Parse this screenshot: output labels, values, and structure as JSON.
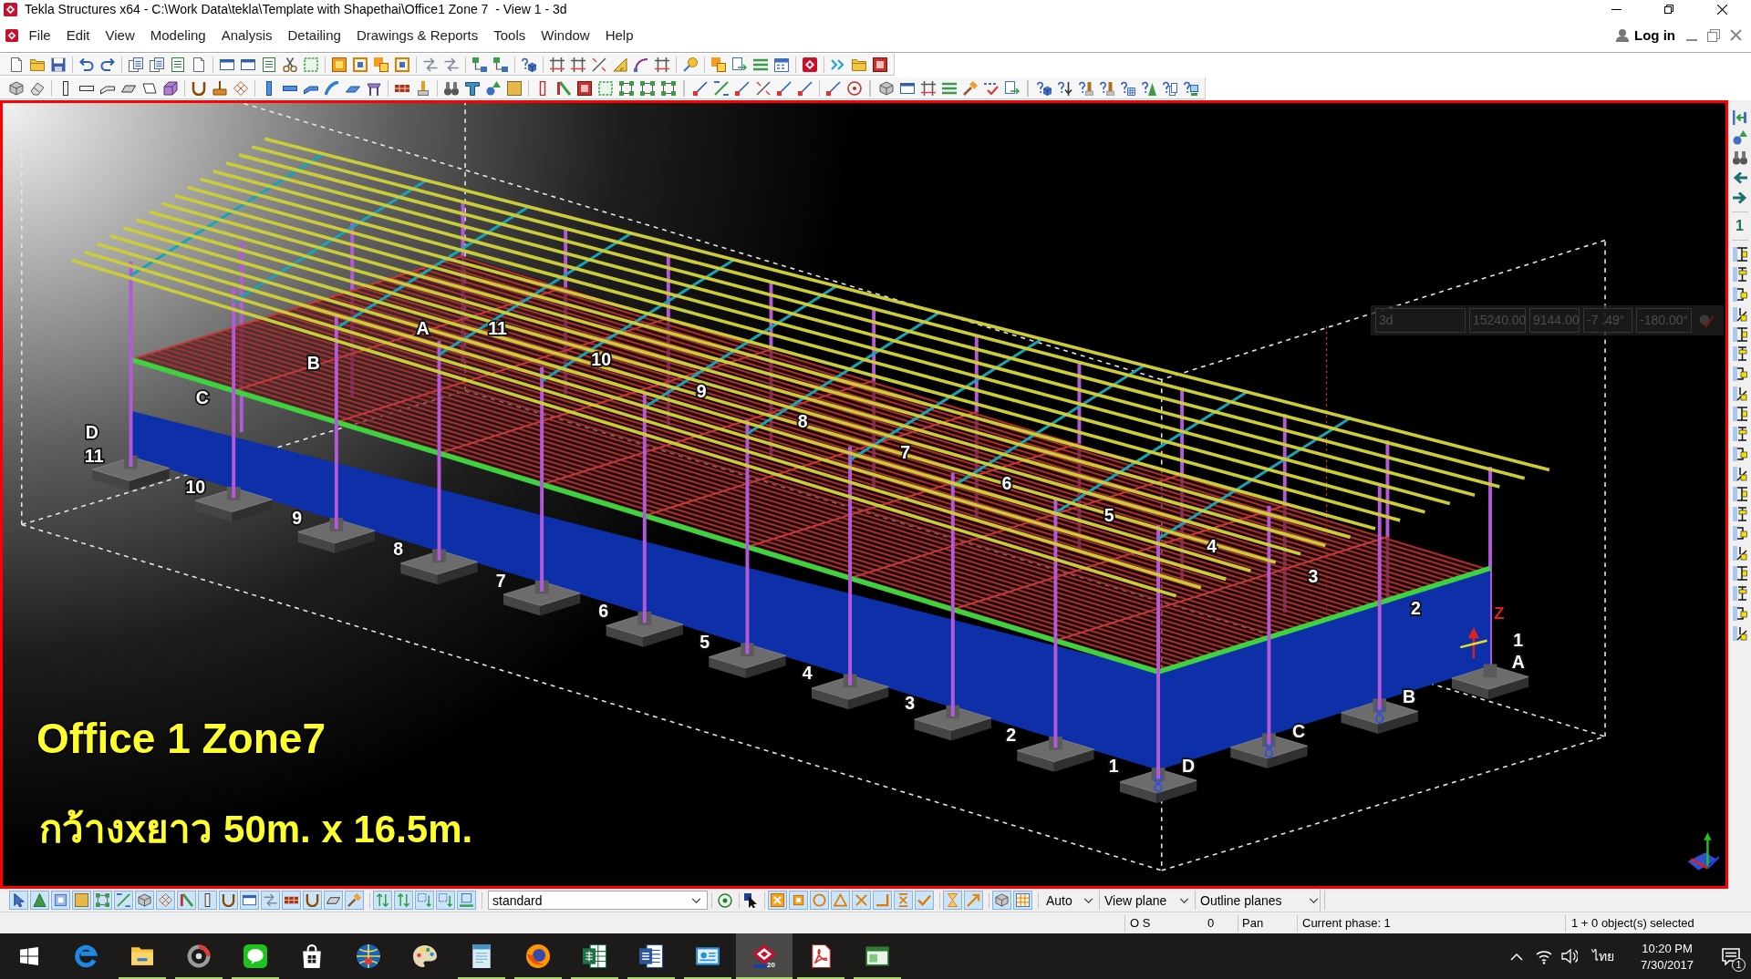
{
  "window": {
    "title": "Tekla Structures x64 - C:\\Work Data\\tekla\\Template with Shapethai\\Office1 Zone 7  - View 1 - 3d"
  },
  "menu": {
    "items": [
      "File",
      "Edit",
      "View",
      "Modeling",
      "Analysis",
      "Detailing",
      "Drawings & Reports",
      "Tools",
      "Window",
      "Help"
    ],
    "login": "Log in"
  },
  "model_view": {
    "view_fields": [
      "3d",
      "15240.00",
      "9144.00",
      "-7 .49°",
      "-180.00°"
    ],
    "grid_labels": [
      "A",
      "11",
      "10",
      "9",
      "8",
      "7",
      "6",
      "5",
      "4",
      "3",
      "2",
      "1",
      "B",
      "C",
      "D",
      "11",
      "10",
      "9",
      "8",
      "7",
      "6",
      "5",
      "4",
      "3",
      "2",
      "1",
      "D",
      "C",
      "B",
      "A"
    ],
    "axis_label": "Z",
    "overlay_title": "Office 1 Zone7",
    "overlay_subtitle": "กว้างxยาว 50m. x 16.5m."
  },
  "right_toolbar": {
    "numeral": "1"
  },
  "bottom_toolbar": {
    "selection_switches": [
      {
        "on": true
      },
      {
        "on": true
      },
      {
        "on": true
      },
      {
        "on": true
      },
      {
        "on": true
      },
      {
        "on": true
      },
      {
        "on": true
      },
      {
        "on": true
      },
      {
        "on": true
      },
      {
        "on": true
      },
      {
        "on": true
      },
      {
        "on": true
      },
      {
        "on": true
      },
      {
        "on": true
      },
      {
        "on": true
      },
      {
        "on": true
      },
      {
        "on": true
      },
      {
        "on": true
      },
      {
        "on": true
      },
      {
        "on": true
      },
      {
        "on": true
      },
      {
        "on": true
      }
    ],
    "filter": "standard",
    "snap_switches": [
      {
        "on": true
      },
      {
        "on": true
      },
      {
        "on": true
      },
      {
        "on": true
      },
      {
        "on": true
      },
      {
        "on": true
      },
      {
        "on": true
      },
      {
        "on": true
      },
      {
        "on": true
      },
      {
        "on": true
      },
      {
        "on": true
      },
      {
        "on": true
      }
    ],
    "dropdowns": [
      "Auto",
      "View plane",
      "Outline planes"
    ]
  },
  "status_bar": {
    "fields": [
      "O S",
      "0",
      "Pan",
      "Current phase: 1",
      "1 + 0 object(s) selected"
    ]
  },
  "taskbar": {
    "apps": [
      {
        "running": false,
        "selected": false
      },
      {
        "running": true,
        "selected": false
      },
      {
        "running": true,
        "selected": false
      },
      {
        "running": true,
        "selected": false
      },
      {
        "running": false,
        "selected": false
      },
      {
        "running": false,
        "selected": false
      },
      {
        "running": false,
        "selected": false
      },
      {
        "running": true,
        "selected": false
      },
      {
        "running": true,
        "selected": false
      },
      {
        "running": true,
        "selected": false
      },
      {
        "running": true,
        "selected": false
      },
      {
        "running": true,
        "selected": false
      },
      {
        "running": true,
        "selected": true,
        "badge": "20"
      },
      {
        "running": true,
        "selected": false
      },
      {
        "running": true,
        "selected": false
      }
    ],
    "language": "ไทย",
    "time": "10:20 PM",
    "date": "7/30/2017",
    "notification_count": "1"
  }
}
